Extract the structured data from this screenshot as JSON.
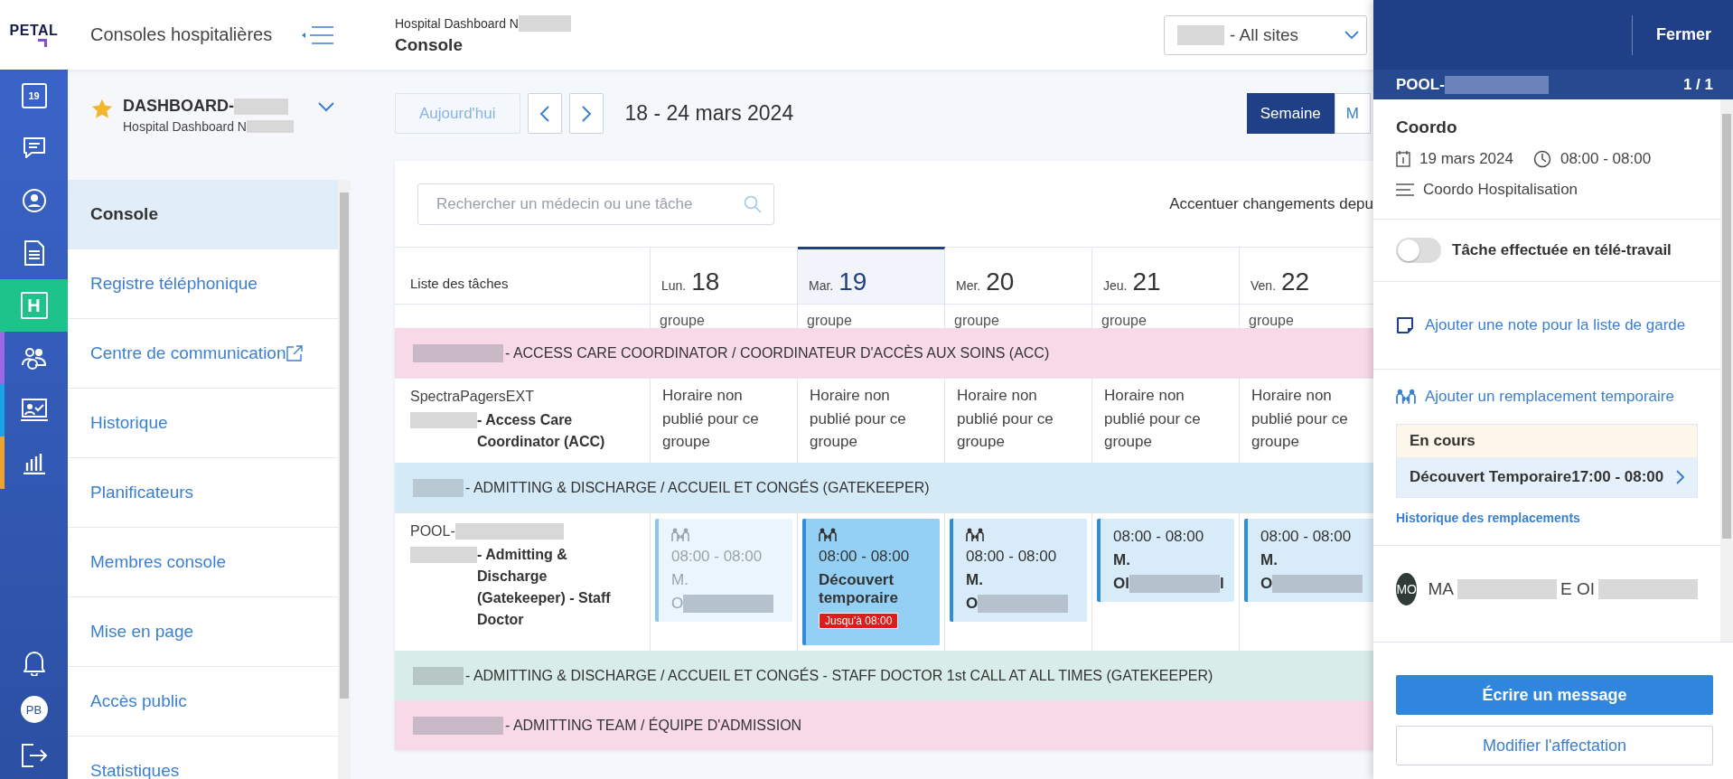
{
  "logo": {
    "text": "PETAL"
  },
  "app_header": {
    "title": "Consoles hospitalières"
  },
  "rail": {
    "items": [
      {
        "kind": "calendar",
        "label": "19",
        "selected": false
      },
      {
        "kind": "chat",
        "selected": false
      },
      {
        "kind": "user",
        "selected": false
      },
      {
        "kind": "document",
        "selected": false
      },
      {
        "kind": "hospital",
        "label": "H",
        "selected": true
      },
      {
        "kind": "people",
        "selected": false,
        "color": "#a066e8"
      },
      {
        "kind": "board",
        "selected": false,
        "color": "#1aa3e8"
      },
      {
        "kind": "chart",
        "selected": false,
        "color": "#f0a32a"
      }
    ],
    "bottom": [
      {
        "kind": "bell"
      },
      {
        "kind": "avatar",
        "label": "PB"
      },
      {
        "kind": "logout"
      }
    ]
  },
  "sidebar": {
    "console": {
      "starred": true,
      "title": [
        {
          "kind": "text",
          "text": "DASHBOARD-"
        },
        {
          "kind": "redacted"
        }
      ],
      "subtitle": [
        {
          "kind": "text",
          "text": "Hospital Dashboard N"
        },
        {
          "kind": "redacted"
        }
      ]
    },
    "items": [
      {
        "label": "Console",
        "selected": true,
        "external": false
      },
      {
        "label": "Registre téléphonique",
        "selected": false,
        "external": false
      },
      {
        "label": "Centre de communication",
        "selected": false,
        "external": true
      },
      {
        "label": "Historique",
        "selected": false,
        "external": false
      },
      {
        "label": "Planificateurs",
        "selected": false,
        "external": false
      },
      {
        "label": "Membres console",
        "selected": false,
        "external": false
      },
      {
        "label": "Mise en page",
        "selected": false,
        "external": false
      },
      {
        "label": "Accès public",
        "selected": false,
        "external": false
      },
      {
        "label": "Statistiques",
        "selected": false,
        "external": false
      }
    ]
  },
  "header": {
    "breadcrumb": [
      {
        "kind": "text",
        "text": "Hospital Dashboard N"
      },
      {
        "kind": "redacted"
      }
    ],
    "title": "Console",
    "site_select": [
      {
        "kind": "redacted"
      },
      {
        "kind": "text",
        "text": "- All sites"
      }
    ]
  },
  "toolbar": {
    "today": "Aujourd'hui",
    "range": "18 - 24 mars 2024",
    "views": [
      {
        "label": "Semaine",
        "selected": true
      },
      {
        "label": "M",
        "selected": false
      }
    ]
  },
  "schedule": {
    "search": {
      "placeholder": "Rechercher un médecin ou une tâche"
    },
    "highlight_label": "Accentuer changements depu",
    "task_column": "Liste des tâches",
    "days": [
      {
        "weekday": "Lun.",
        "date": "18",
        "selected": false
      },
      {
        "weekday": "Mar.",
        "date": "19",
        "selected": true
      },
      {
        "weekday": "Mer.",
        "date": "20",
        "selected": false
      },
      {
        "weekday": "Jeu.",
        "date": "21",
        "selected": false
      },
      {
        "weekday": "Ven.",
        "date": "22",
        "selected": false
      }
    ],
    "rows": [
      {
        "kind": "partial",
        "cells": [
          "groupe",
          "groupe",
          "groupe",
          "groupe",
          "groupe"
        ]
      },
      {
        "kind": "group",
        "color": "#f7d9e8",
        "title": [
          {
            "kind": "redacted"
          },
          {
            "kind": "text",
            "text": "- ACCESS CARE COORDINATOR / COORDINATEUR D'ACCÈS AUX SOINS (ACC)"
          }
        ]
      },
      {
        "kind": "task",
        "line1": [
          {
            "kind": "text",
            "text": "SpectraPagersEXT"
          }
        ],
        "line2": [
          {
            "kind": "redacted"
          },
          {
            "kind": "text",
            "text": " - Access Care Coordinator (ACC)"
          }
        ],
        "cells": [
          {
            "kind": "unpublished",
            "text": "Horaire non publié pour ce groupe"
          },
          {
            "kind": "unpublished",
            "text": "Horaire non publié pour ce groupe"
          },
          {
            "kind": "unpublished",
            "text": "Horaire non publié pour ce groupe"
          },
          {
            "kind": "unpublished",
            "text": "Horaire non publié pour ce groupe"
          },
          {
            "kind": "unpublished",
            "text": "Horaire non publié pour ce groupe"
          }
        ]
      },
      {
        "kind": "group",
        "color": "#d5eaf7",
        "title": [
          {
            "kind": "redacted"
          },
          {
            "kind": "text",
            "text": " - ADMITTING & DISCHARGE / ACCUEIL ET CONGÉS (GATEKEEPER)"
          }
        ]
      },
      {
        "kind": "task",
        "line1": [
          {
            "kind": "text",
            "text": "POOL-"
          },
          {
            "kind": "redacted"
          }
        ],
        "line2": [
          {
            "kind": "redacted"
          },
          {
            "kind": "text",
            "text": "- Admitting & Discharge (Gatekeeper) - Staff Doctor"
          }
        ],
        "cells": [
          {
            "kind": "shift",
            "past": true,
            "selected": false,
            "replacement": true,
            "time": "08:00 - 08:00",
            "lines": [
              [
                {
                  "kind": "text",
                  "text": "M."
                }
              ],
              [
                {
                  "kind": "text",
                  "text": "O"
                },
                {
                  "kind": "redacted"
                }
              ]
            ]
          },
          {
            "kind": "shift",
            "past": false,
            "selected": true,
            "replacement": true,
            "time": "08:00 - 08:00",
            "lines": [
              [
                {
                  "kind": "text",
                  "text": "Découvert temporaire"
                }
              ]
            ],
            "badge": "Jusqu'à 08:00"
          },
          {
            "kind": "shift",
            "past": false,
            "selected": false,
            "replacement": true,
            "time": "08:00 - 08:00",
            "lines": [
              [
                {
                  "kind": "text",
                  "text": "M."
                }
              ],
              [
                {
                  "kind": "text",
                  "text": "O"
                },
                {
                  "kind": "redacted"
                }
              ]
            ]
          },
          {
            "kind": "shift",
            "past": false,
            "selected": false,
            "replacement": false,
            "time": "08:00 - 08:00",
            "lines": [
              [
                {
                  "kind": "text",
                  "text": "M."
                }
              ],
              [
                {
                  "kind": "text",
                  "text": "Ol"
                },
                {
                  "kind": "redacted"
                },
                {
                  "kind": "text",
                  "text": "l"
                }
              ]
            ]
          },
          {
            "kind": "shift",
            "past": false,
            "selected": false,
            "replacement": false,
            "time": "08:00 - 08:00",
            "lines": [
              [
                {
                  "kind": "text",
                  "text": "M."
                }
              ],
              [
                {
                  "kind": "text",
                  "text": "O"
                },
                {
                  "kind": "redacted"
                }
              ]
            ]
          }
        ]
      },
      {
        "kind": "group",
        "color": "#d8ece8",
        "title": [
          {
            "kind": "redacted"
          },
          {
            "kind": "text",
            "text": "- ADMITTING & DISCHARGE / ACCUEIL ET CONGÉS - STAFF DOCTOR 1st CALL AT ALL TIMES (GATEKEEPER)"
          }
        ]
      },
      {
        "kind": "group",
        "color": "#f7d9e8",
        "title": [
          {
            "kind": "redacted"
          },
          {
            "kind": "text",
            "text": "- ADMITTING TEAM / ÉQUIPE D'ADMISSION"
          }
        ]
      }
    ]
  },
  "panel": {
    "close": "Fermer",
    "pool": [
      {
        "kind": "text",
        "text": "POOL-"
      },
      {
        "kind": "redacted"
      }
    ],
    "counter": "1 / 1",
    "title": "Coordo",
    "date": "19 mars 2024",
    "time": "08:00 - 08:00",
    "group": "Coordo Hospitalisation",
    "remote": {
      "label": "Tâche effectuée en télé-travail",
      "on": false
    },
    "note_link": "Ajouter une note pour la liste de garde",
    "replace_link": "Ajouter un remplacement temporaire",
    "current": {
      "title": "En cours",
      "entry": "Découvert Temporaire17:00 - 08:00"
    },
    "history_link": "Historique des remplacements",
    "person": {
      "initials": "MO",
      "name": [
        {
          "kind": "text",
          "text": "MA"
        },
        {
          "kind": "redacted"
        },
        {
          "kind": "text",
          "text": "E OI"
        },
        {
          "kind": "redacted"
        }
      ]
    },
    "buttons": [
      {
        "kind": "primary",
        "label": "Écrire un message"
      },
      {
        "kind": "secondary",
        "label": "Modifier l'affectation"
      }
    ]
  }
}
